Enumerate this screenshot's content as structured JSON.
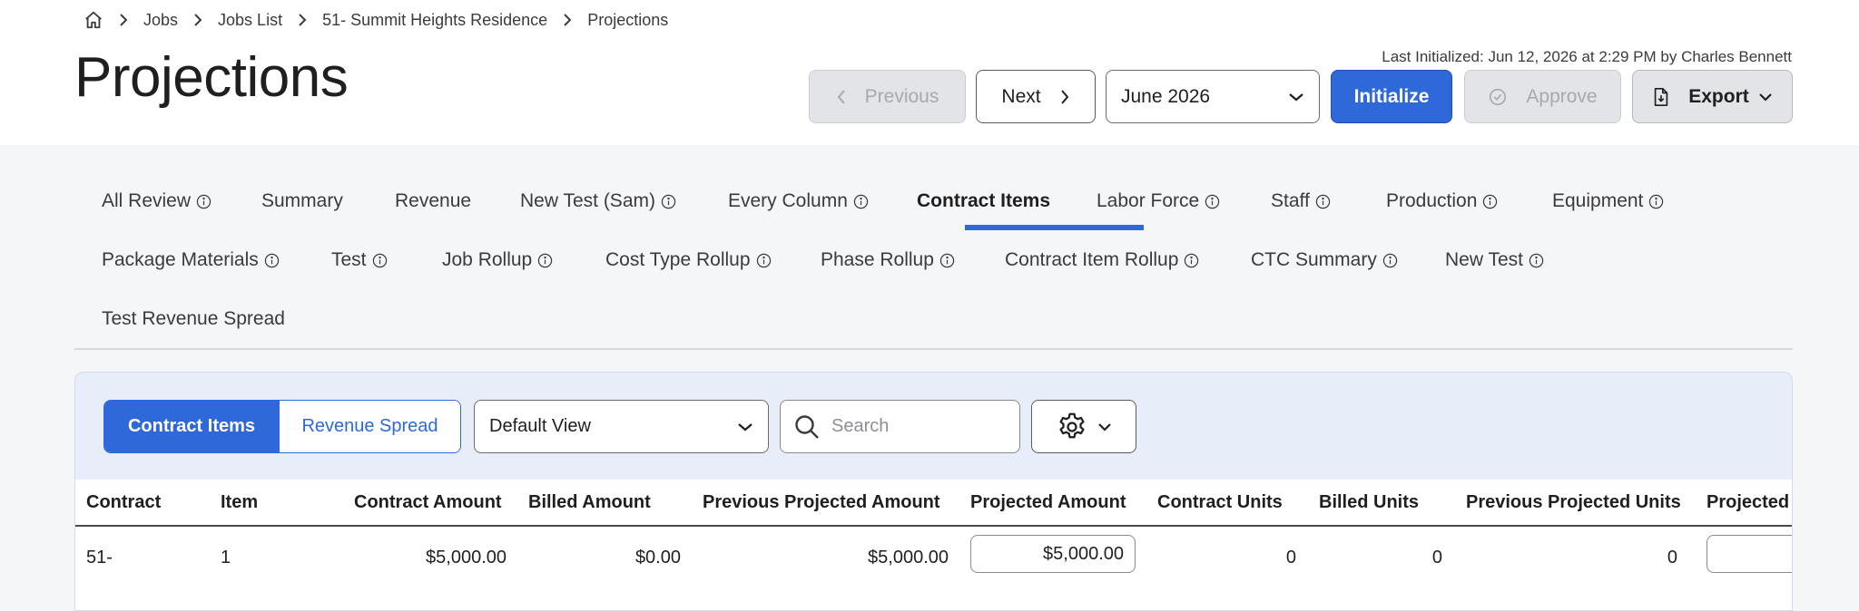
{
  "breadcrumb": {
    "items": [
      "Jobs",
      "Jobs List",
      "51- Summit Heights Residence",
      "Projections"
    ]
  },
  "header": {
    "title": "Projections",
    "last_initialized": "Last Initialized: Jun 12, 2026 at 2:29 PM by Charles Bennett"
  },
  "toolbar": {
    "previous_label": "Previous",
    "next_label": "Next",
    "month_value": "June 2026",
    "initialize_label": "Initialize",
    "approve_label": "Approve",
    "export_label": "Export"
  },
  "tabs": [
    {
      "label": "All Review",
      "info": true
    },
    {
      "label": "Summary",
      "info": false
    },
    {
      "label": "Revenue",
      "info": false
    },
    {
      "label": "New Test (Sam)",
      "info": true
    },
    {
      "label": "Every Column",
      "info": true
    },
    {
      "label": "Contract Items",
      "info": false,
      "active": true
    },
    {
      "label": "Labor Force",
      "info": true
    },
    {
      "label": "Staff",
      "info": true
    },
    {
      "label": "Production",
      "info": true
    },
    {
      "label": "Equipment",
      "info": true
    },
    {
      "label": "Package Materials",
      "info": true
    },
    {
      "label": "Test",
      "info": true
    },
    {
      "label": "Job Rollup",
      "info": true
    },
    {
      "label": "Cost Type Rollup",
      "info": true
    },
    {
      "label": "Phase Rollup",
      "info": true
    },
    {
      "label": "Contract Item Rollup",
      "info": true
    },
    {
      "label": "CTC Summary",
      "info": true
    },
    {
      "label": "New Test",
      "info": true
    },
    {
      "label": "Test Revenue Spread",
      "info": false
    }
  ],
  "panel": {
    "segment_active": "Contract Items",
    "segment_other": "Revenue Spread",
    "view_value": "Default View",
    "search_placeholder": "Search"
  },
  "table": {
    "columns": [
      "Contract",
      "Item",
      "Contract Amount",
      "Billed Amount",
      "Previous Projected Amount",
      "Projected Amount",
      "Contract Units",
      "Billed Units",
      "Previous Projected Units",
      "Projected"
    ],
    "rows": [
      {
        "contract": "51-",
        "item": "1",
        "contract_amount": "$5,000.00",
        "billed_amount": "$0.00",
        "previous_projected_amount": "$5,000.00",
        "projected_amount": "$5,000.00",
        "contract_units": "0",
        "billed_units": "0",
        "previous_projected_units": "0",
        "projected_units": ""
      }
    ]
  },
  "colors": {
    "primary": "#2f68d8",
    "disabled_bg": "#e2e4e8",
    "panel_bg": "#e7eef9"
  }
}
